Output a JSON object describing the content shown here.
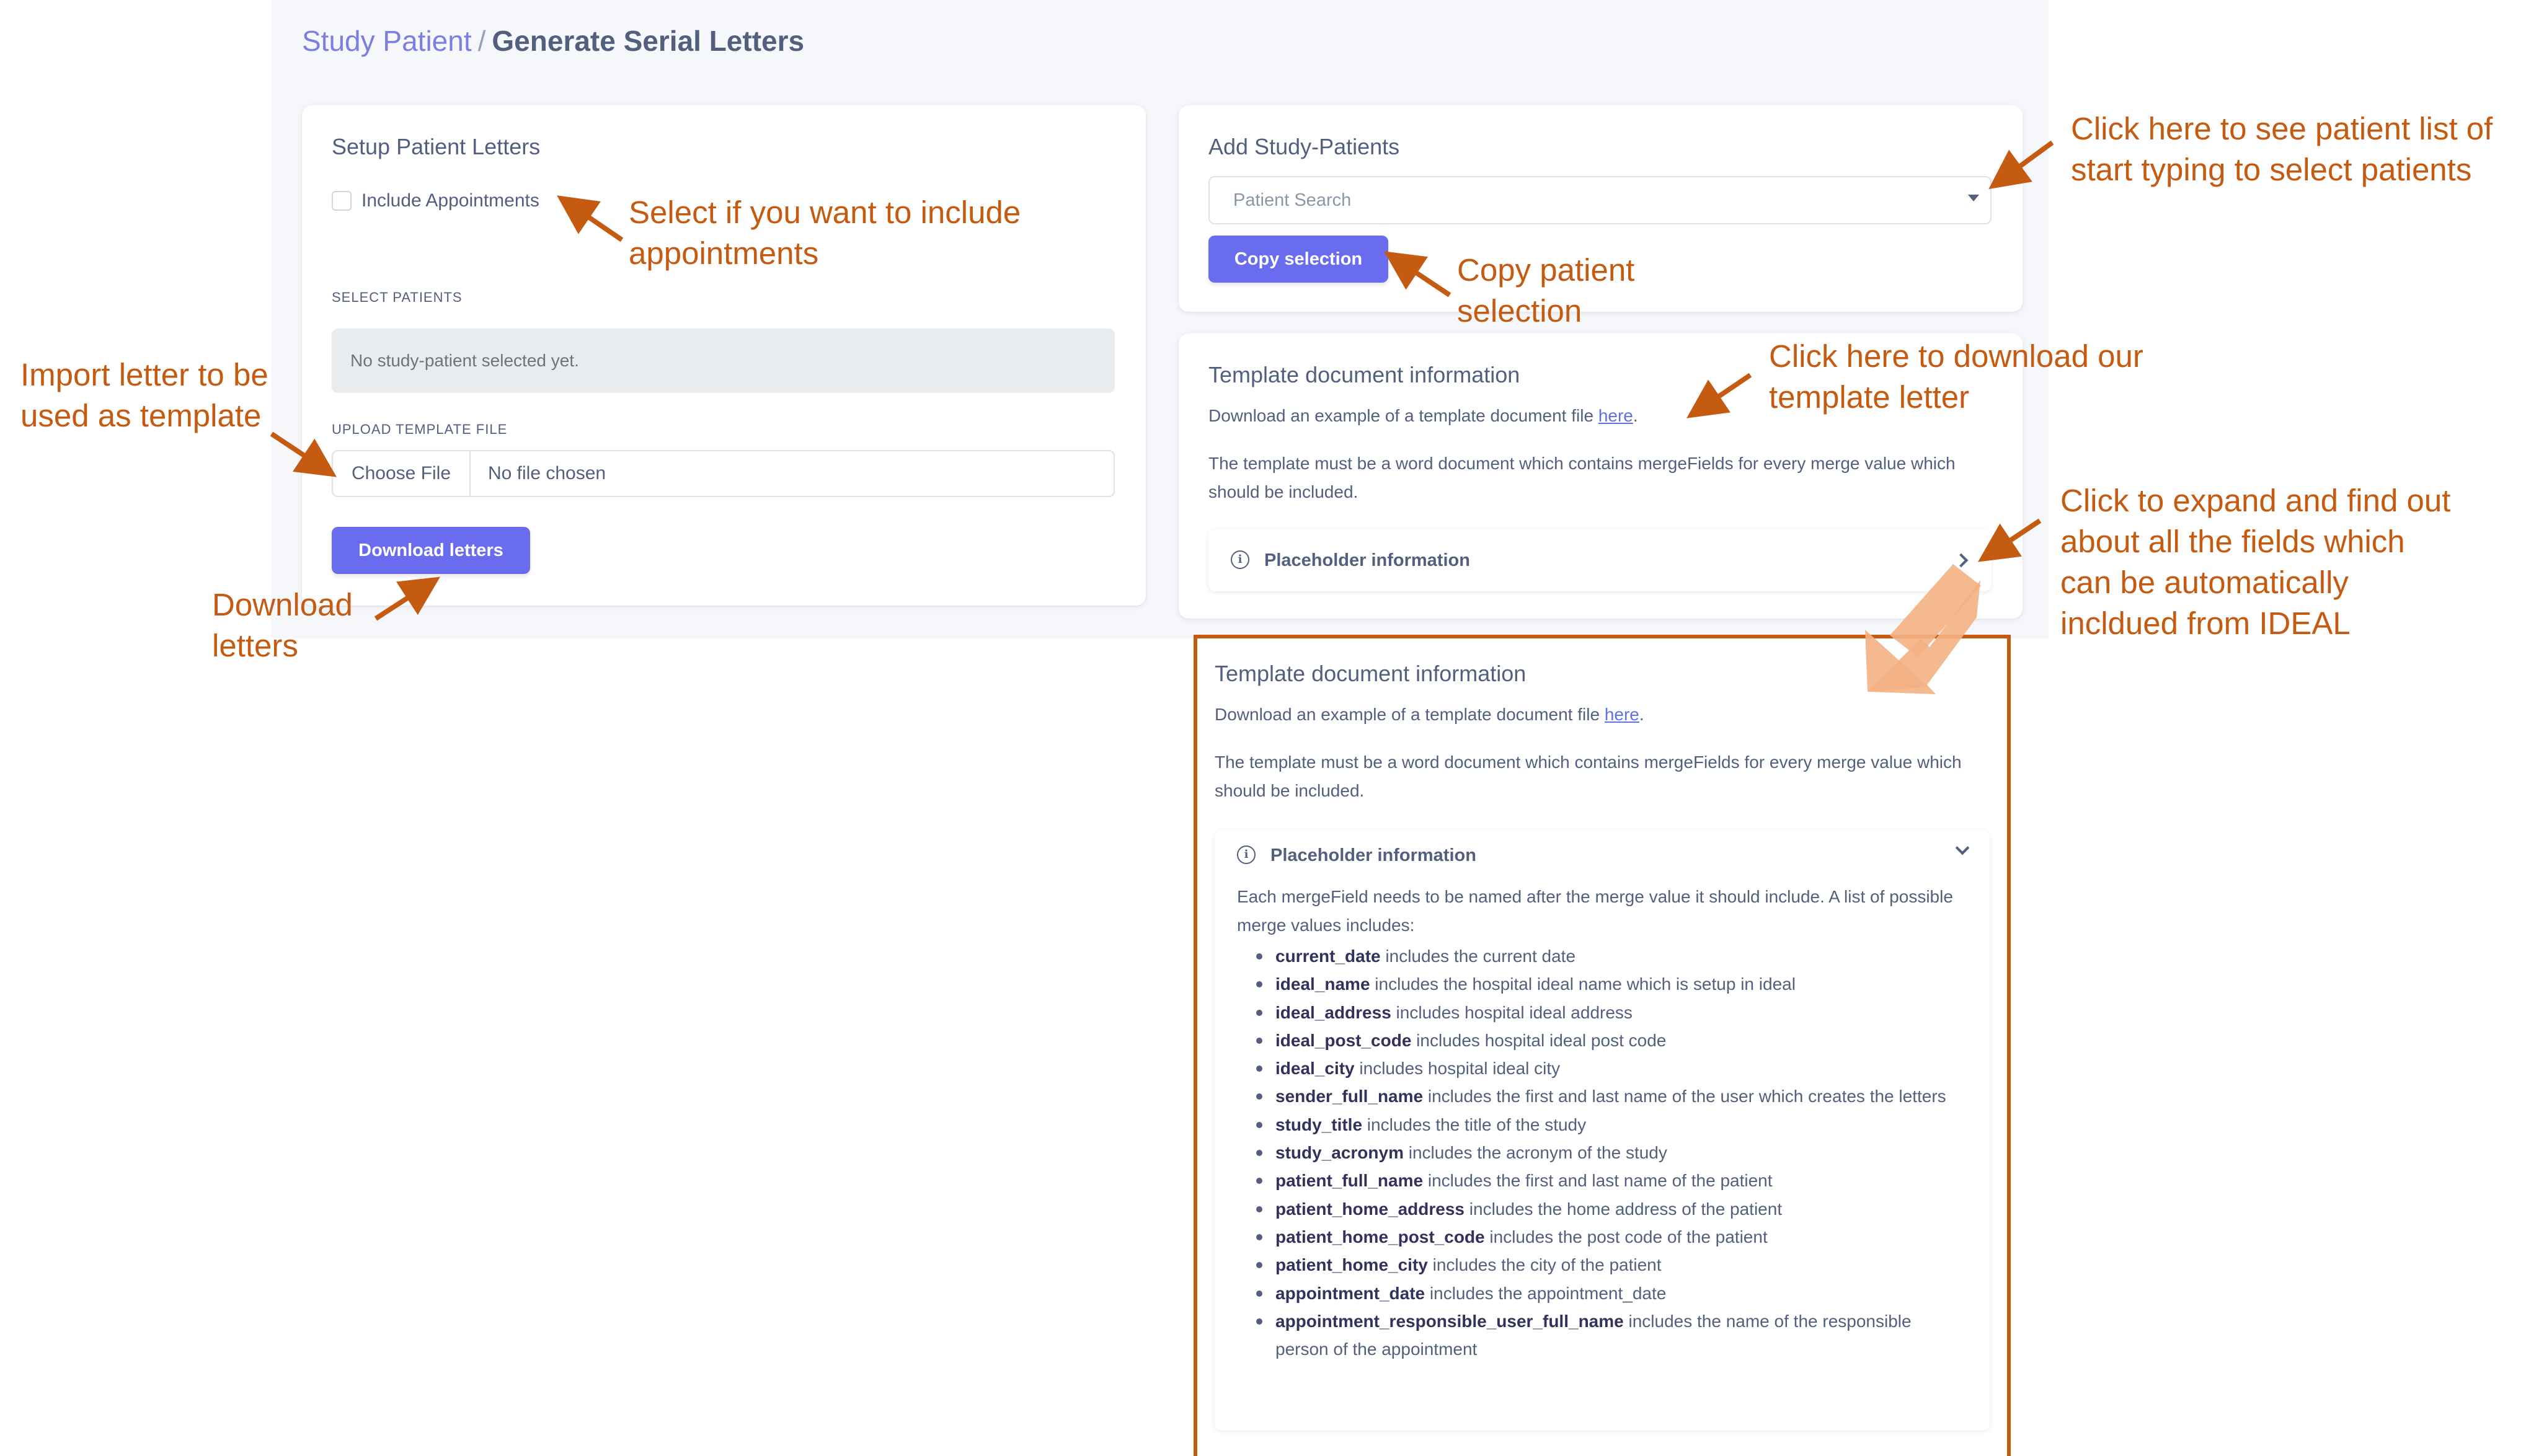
{
  "breadcrumb": {
    "parent": "Study Patient",
    "separator": "/",
    "current": "Generate Serial Letters"
  },
  "setup_card": {
    "title": "Setup Patient Letters",
    "include_appointments_label": "Include Appointments",
    "include_appointments_checked": false,
    "select_patients_label": "SELECT PATIENTS",
    "no_patients_text": "No study-patient selected yet.",
    "upload_label": "UPLOAD TEMPLATE FILE",
    "choose_file_label": "Choose File",
    "no_file_text": "No file chosen",
    "download_button": "Download letters"
  },
  "add_card": {
    "title": "Add Study-Patients",
    "search_placeholder": "Patient Search",
    "copy_button": "Copy selection"
  },
  "template_card": {
    "title": "Template document information",
    "download_text": "Download an example of a template document file",
    "download_link": "here",
    "download_suffix": ".",
    "description": "The template must be a word document which contains mergeFields for every merge value which should be included.",
    "placeholder_title": "Placeholder information"
  },
  "expanded_card": {
    "title": "Template document information",
    "download_text": "Download an example of a template document file",
    "download_link": "here",
    "download_suffix": ".",
    "description": "The template must be a word document which contains mergeFields for every merge value which should be included.",
    "placeholder_title": "Placeholder information",
    "intro": "Each mergeField needs to be named after the merge value it should include. A list of possible merge values includes:",
    "fields": [
      {
        "name": "current_date",
        "desc": " includes the current date"
      },
      {
        "name": "ideal_name",
        "desc": " includes the hospital ideal name which is setup in ideal"
      },
      {
        "name": "ideal_address",
        "desc": " includes hospital ideal address"
      },
      {
        "name": "ideal_post_code",
        "desc": " includes hospital ideal post code"
      },
      {
        "name": "ideal_city",
        "desc": " includes hospital ideal city"
      },
      {
        "name": "sender_full_name",
        "desc": " includes the first and last name of the user which creates the letters"
      },
      {
        "name": "study_title",
        "desc": " includes the title of the study"
      },
      {
        "name": "study_acronym",
        "desc": " includes the acronym of the study"
      },
      {
        "name": "patient_full_name",
        "desc": " includes the first and last name of the patient"
      },
      {
        "name": "patient_home_address",
        "desc": " includes the home address of the patient"
      },
      {
        "name": "patient_home_post_code",
        "desc": " includes the post code of the patient"
      },
      {
        "name": "patient_home_city",
        "desc": " includes the city of the patient"
      },
      {
        "name": "appointment_date",
        "desc": " includes the appointment_date"
      },
      {
        "name": "appointment_responsible_user_full_name",
        "desc": " includes the name of the responsible person of the appointment"
      }
    ]
  },
  "annotations": {
    "include_appointments": [
      "Select if you want to include",
      "appointments"
    ],
    "import_template": [
      "Import letter to be",
      "used as template"
    ],
    "download_letters": [
      "Download",
      "letters"
    ],
    "patient_list": [
      "Click here to see patient list of",
      "start typing to select patients"
    ],
    "copy_selection": [
      "Copy patient",
      "selection"
    ],
    "download_template": [
      "Click here to download our",
      "template letter"
    ],
    "expand_fields": [
      "Click to expand and find out",
      "about all the fields which",
      "can be automatically",
      "incldued from IDEAL"
    ]
  },
  "colors": {
    "annotation": "#c55a11",
    "primary_button": "#6a6cf0",
    "link": "#5e72e4",
    "breadcrumb_link": "#7a7fe0",
    "text": "#525f7f",
    "expand_arrow": "#f4b183"
  }
}
